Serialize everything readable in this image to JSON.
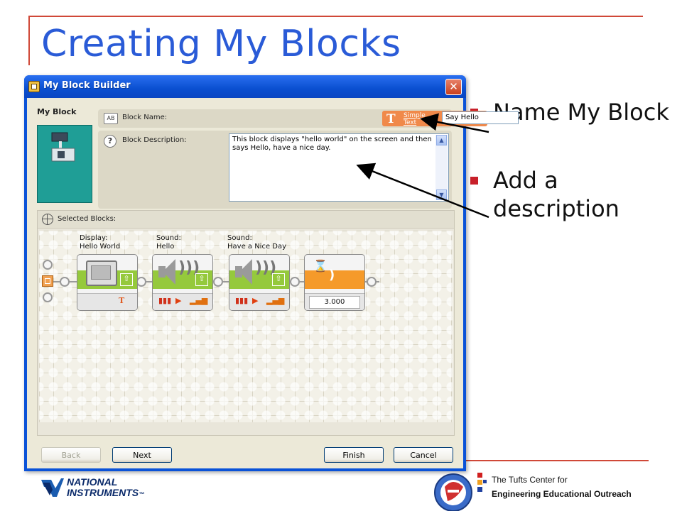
{
  "slide": {
    "title": "Creating My Blocks",
    "bullets": [
      "Name My Block",
      "Add a description"
    ]
  },
  "window": {
    "title": "My Block Builder",
    "close_glyph": "✕"
  },
  "left_panel": {
    "label": "My Block"
  },
  "block_name": {
    "label": "Block Name:",
    "type_label_line1": "Simple",
    "type_label_line2": "Text",
    "value": "Say Hello"
  },
  "block_description": {
    "label": "Block Description:",
    "value": "This block displays \"hello world\" on the screen and then says Hello, have a nice day."
  },
  "selected_blocks": {
    "label": "Selected Blocks:",
    "blocks": [
      {
        "title_line1": "Display:",
        "title_line2": "Hello World",
        "kind": "display"
      },
      {
        "title_line1": "Sound:",
        "title_line2": "Hello",
        "kind": "sound"
      },
      {
        "title_line1": "Sound:",
        "title_line2": "Have a Nice Day",
        "kind": "sound"
      },
      {
        "title_line1": "",
        "title_line2": "",
        "kind": "wait",
        "value": "3.000"
      }
    ]
  },
  "buttons": {
    "back": "Back",
    "next": "Next",
    "finish": "Finish",
    "cancel": "Cancel"
  },
  "logos": {
    "ni_line1": "NATIONAL",
    "ni_line2": "INSTRUMENTS",
    "ni_tm": "™",
    "ceeo_line1": "The Tufts Center for",
    "ceeo_line2": "Engineering Educational Outreach"
  },
  "colors": {
    "title_blue": "#2a5bd7",
    "bullet_red": "#c8202a",
    "xp_blue": "#0a52d8",
    "block_green": "#95c93c",
    "block_orange": "#f59a2a",
    "teal_tile": "#1f9e96"
  }
}
